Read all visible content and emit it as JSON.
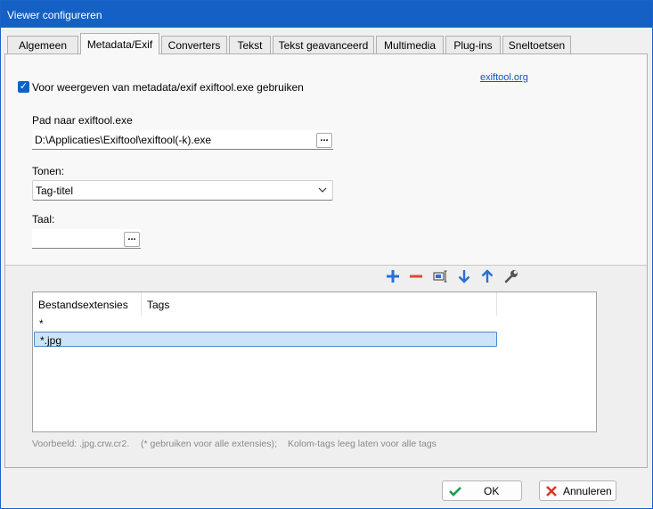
{
  "window": {
    "title": "Viewer configureren"
  },
  "tabs": [
    {
      "label": "Algemeen"
    },
    {
      "label": "Metadata/Exif"
    },
    {
      "label": "Converters"
    },
    {
      "label": "Tekst"
    },
    {
      "label": "Tekst geavanceerd"
    },
    {
      "label": "Multimedia"
    },
    {
      "label": "Plug-ins"
    },
    {
      "label": "Sneltoetsen"
    }
  ],
  "active_tab": "Metadata/Exif",
  "metadata": {
    "use_exiftool_label": "Voor weergeven van metadata/exif exiftool.exe gebruiken",
    "use_exiftool_checked": true,
    "exiftool_link": "exiftool.org",
    "path_label": "Pad naar exiftool.exe",
    "path_value": "D:\\Applicaties\\Exiftool\\exiftool(-k).exe",
    "browse_label": "...",
    "show_label": "Tonen:",
    "show_value": "Tag-titel",
    "language_label": "Taal:",
    "language_value": ""
  },
  "toolbar": {
    "icons": [
      "add-icon",
      "remove-icon",
      "edit-icon",
      "move-down-icon",
      "move-up-icon",
      "wrench-icon"
    ]
  },
  "list": {
    "columns": [
      "Bestandsextensies",
      "Tags"
    ],
    "rows": [
      {
        "ext": "*",
        "tags": ""
      },
      {
        "ext": "*.jpg",
        "tags": ""
      }
    ],
    "selected_row": 1
  },
  "hints": {
    "example": "Voorbeeld: .jpg.crw.cr2.",
    "all_ext": "(* gebruiken voor alle extensies);",
    "col_tags": "Kolom-tags leeg laten voor alle tags"
  },
  "buttons": {
    "ok": "OK",
    "cancel": "Annuleren"
  },
  "colors": {
    "title_bar": "#1560c4",
    "accent": "#0a64c8",
    "ok_check": "#1e9b50",
    "cancel_x": "#d13c2a"
  }
}
